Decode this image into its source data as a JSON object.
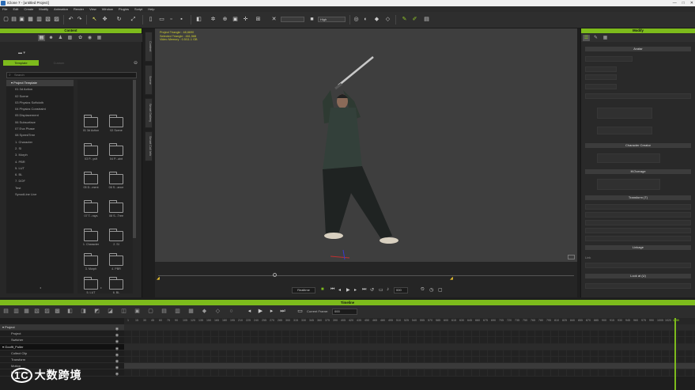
{
  "window": {
    "title": "iClone 7 - [untitled Project]",
    "min": "—",
    "max": "□",
    "close": "✕"
  },
  "menu": [
    "File",
    "Edit",
    "Create",
    "Modify",
    "Animation",
    "Render",
    "View",
    "Window",
    "Plugins",
    "Script",
    "Help"
  ],
  "toolbar": {
    "render_quality": "High",
    "zoom_field": ""
  },
  "content": {
    "title": "Content",
    "tab_template": "Template",
    "tab_custom": "Custom",
    "search_placeholder": "Search",
    "tree_root": "Project Template",
    "tree_items": [
      "01 3d Action",
      "02 Scene",
      "03 Physics Softcloth",
      "04 Physics Constraint",
      "05 Displacement",
      "06 Subsurface",
      "07 Eva Phase",
      "08 SpeedTree",
      "1. Character",
      "2. SI",
      "3. Morph",
      "4. PBR",
      "5. LUT",
      "6. BL",
      "7. DOF",
      "Test",
      "SynodLine Live"
    ],
    "folders": [
      "01 3d Action",
      "02 Scene",
      "03 P...ysft",
      "04 P...aint",
      "05 D...ment",
      "06 S...ance",
      "07 T...rays",
      "08 S...Tree",
      "1. Character",
      "2. SI",
      "3. Morph",
      "4. PBR",
      "5. LUT",
      "6. BL"
    ]
  },
  "side_tabs": [
    "Content",
    "Scene",
    "Smart Gallery",
    "Smart Cull Info"
  ],
  "viewport": {
    "stats": [
      "Project Triangle : 48,6690",
      "Selected Triangle : 461,588",
      "Video Memory : 0.5/11.1 GB"
    ],
    "playback_mode": "Realtime",
    "frame": "000"
  },
  "modify": {
    "title": "Modify",
    "sections": [
      "Avatar",
      "Character Creator",
      "IKOverage",
      "Transform (T)",
      "Linkage",
      "Look at (U)"
    ],
    "label_link": "Link"
  },
  "timeline": {
    "title": "Timeline",
    "current_frame_label": "Current Frame:",
    "current_frame_value": "000",
    "ticks": [
      "1",
      "15",
      "30",
      "45",
      "60",
      "75",
      "90",
      "105",
      "120",
      "135",
      "150",
      "165",
      "180",
      "195",
      "210",
      "225",
      "240",
      "255",
      "270",
      "285",
      "300",
      "315",
      "330",
      "345",
      "360",
      "375",
      "390",
      "405",
      "420",
      "435",
      "450",
      "465",
      "480",
      "495",
      "510",
      "525",
      "540",
      "555",
      "570",
      "585",
      "600",
      "615",
      "630",
      "645",
      "660",
      "675",
      "690",
      "705",
      "720",
      "735",
      "750",
      "765",
      "780",
      "795",
      "810",
      "825",
      "840",
      "855",
      "870",
      "885",
      "900",
      "915",
      "930",
      "945",
      "960",
      "975",
      "990",
      "1005",
      "1020",
      "1035",
      "1050"
    ],
    "end_frame": "1050",
    "tracks": [
      {
        "label": "Project",
        "header": true
      },
      {
        "label": "Project",
        "header": false
      },
      {
        "label": "Switcher",
        "header": false
      },
      {
        "label": "Goofft_Puller",
        "header": true
      },
      {
        "label": "Collect Clip",
        "header": false
      },
      {
        "label": "Transform",
        "header": false
      },
      {
        "label": "Motion",
        "header": false
      },
      {
        "label": "Motion Layer",
        "header": false
      }
    ]
  },
  "watermark": {
    "brand": "大数跨境",
    "mark": "1C"
  },
  "colors": {
    "accent": "#7dbb1c",
    "viewport_bg": "#3e3e3e",
    "info_text": "#cfcf30"
  }
}
